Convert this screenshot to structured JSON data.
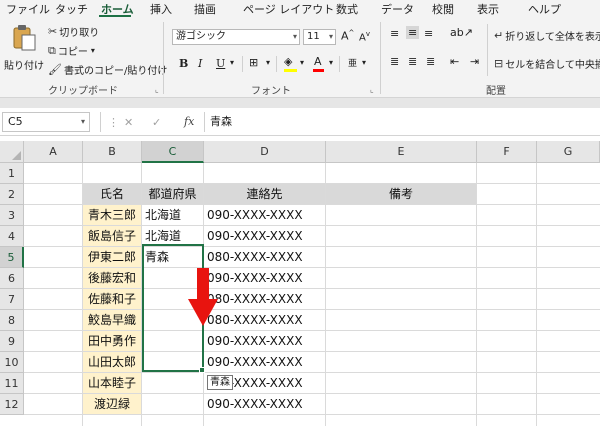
{
  "ribbon_tabs": [
    "ファイル",
    "タッチ",
    "ホーム",
    "挿入",
    "描画",
    "ページ レイアウト",
    "数式",
    "データ",
    "校閲",
    "表示",
    "ヘルプ"
  ],
  "active_tab": "ホーム",
  "clipboard": {
    "paste_label": "貼り付け",
    "cut_label": "切り取り",
    "copy_label": "コピー",
    "format_painter_label": "書式のコピー/貼り付け",
    "group_label": "クリップボード"
  },
  "font": {
    "name": "游ゴシック",
    "size": "11",
    "group_label": "フォント",
    "grow_label": "A",
    "shrink_label": "A",
    "bold": "B",
    "italic": "I",
    "underline": "U",
    "font_color_label": "A",
    "phonetic_label": "亜"
  },
  "alignment": {
    "wrap_label": "折り返して全体を表示",
    "merge_label": "セルを結合して中央揃",
    "group_label": "配置"
  },
  "formula_bar": {
    "name_box": "C5",
    "fx": "fx",
    "value": "青森"
  },
  "columns": [
    "A",
    "B",
    "C",
    "D",
    "E",
    "F",
    "G"
  ],
  "selected_column": "C",
  "rows": [
    "1",
    "2",
    "3",
    "4",
    "5",
    "6",
    "7",
    "8",
    "9",
    "10",
    "11",
    "12"
  ],
  "selected_row": "5",
  "table": {
    "headers": [
      "氏名",
      "都道府県",
      "連絡先",
      "備考"
    ],
    "rows": [
      {
        "name": "青木三郎",
        "pref": "北海道",
        "contact": "090-XXXX-XXXX"
      },
      {
        "name": "飯島信子",
        "pref": "北海道",
        "contact": "090-XXXX-XXXX"
      },
      {
        "name": "伊東二郎",
        "pref": "青森",
        "contact": "080-XXXX-XXXX"
      },
      {
        "name": "後藤宏和",
        "pref": "",
        "contact": "090-XXXX-XXXX"
      },
      {
        "name": "佐藤和子",
        "pref": "",
        "contact": "080-XXXX-XXXX"
      },
      {
        "name": "鮫島早織",
        "pref": "",
        "contact": "080-XXXX-XXXX"
      },
      {
        "name": "田中勇作",
        "pref": "",
        "contact": "090-XXXX-XXXX"
      },
      {
        "name": "山田太郎",
        "pref": "",
        "contact": "090-XXXX-XXXX"
      },
      {
        "name": "山本睦子",
        "pref": "",
        "contact": "090-XXXX-XXXX"
      },
      {
        "name": "渡辺緑",
        "pref": "",
        "contact": "090-XXXX-XXXX"
      }
    ]
  },
  "autofill_tooltip": "青森",
  "colors": {
    "accent": "#217346",
    "header_fill": "#d9d9d9",
    "name_fill": "#fff2cc",
    "arrow": "#e8140f"
  }
}
